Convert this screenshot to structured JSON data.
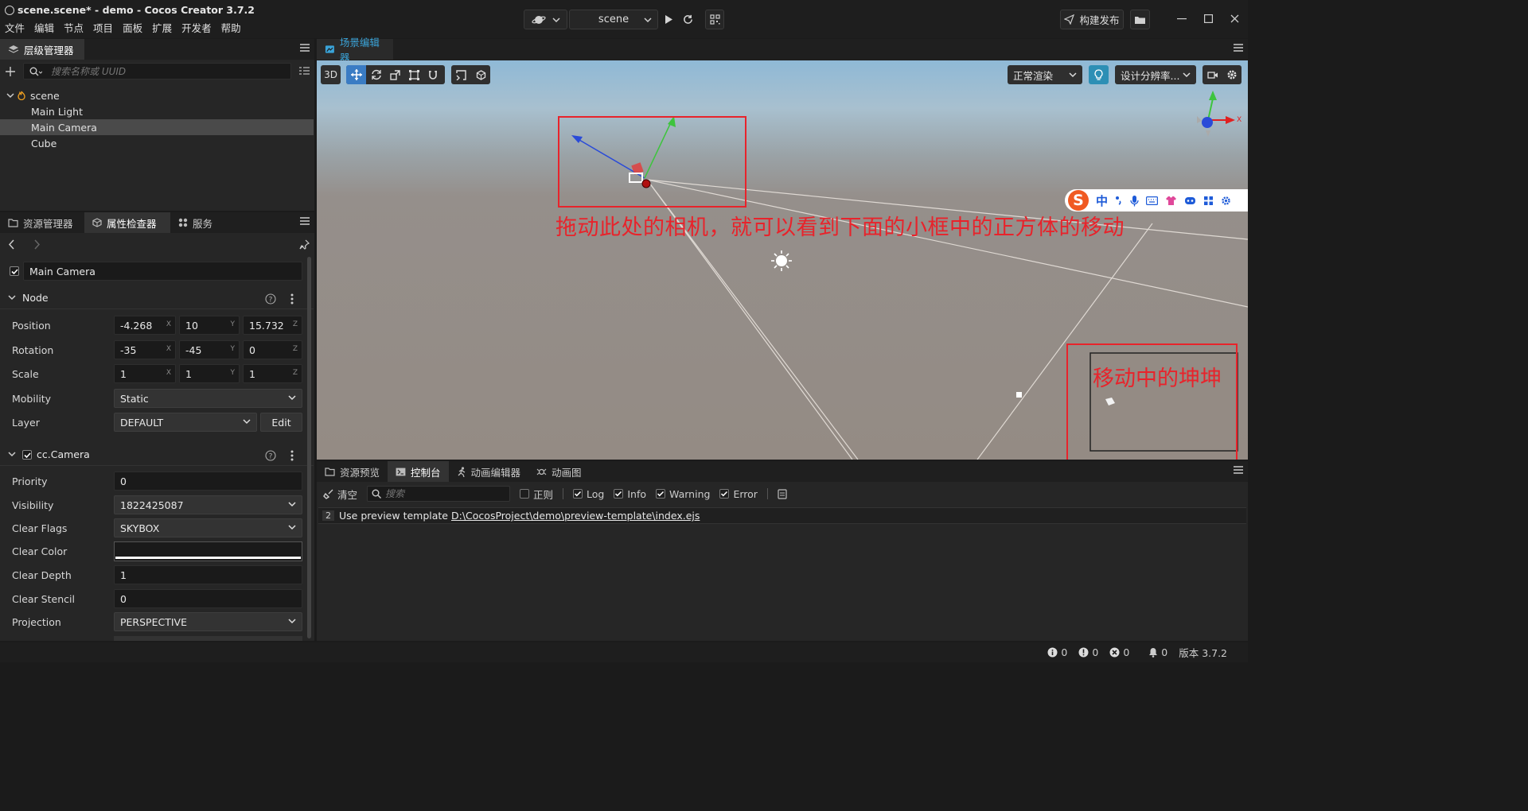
{
  "window": {
    "title": "scene.scene* - demo - Cocos Creator 3.7.2",
    "menu": [
      "文件",
      "编辑",
      "节点",
      "项目",
      "面板",
      "扩展",
      "开发者",
      "帮助"
    ],
    "scene_select": "scene",
    "build_button": "构建发布"
  },
  "hierarchy": {
    "tab": "层级管理器",
    "search_placeholder": "搜索名称或 UUID",
    "root": "scene",
    "items": [
      "Main Light",
      "Main Camera",
      "Cube"
    ],
    "selected": "Main Camera"
  },
  "inspector": {
    "tabs": [
      "资源管理器",
      "属性检查器",
      "服务"
    ],
    "node_name": "Main Camera",
    "node_section": "Node",
    "position_label": "Position",
    "rotation_label": "Rotation",
    "scale_label": "Scale",
    "mobility_label": "Mobility",
    "layer_label": "Layer",
    "position": {
      "x": "-4.268",
      "y": "10",
      "z": "15.732"
    },
    "rotation": {
      "x": "-35",
      "y": "-45",
      "z": "0"
    },
    "scale": {
      "x": "1",
      "y": "1",
      "z": "1"
    },
    "mobility": "Static",
    "layer": "DEFAULT",
    "edit_button": "Edit",
    "camera_section": "cc.Camera",
    "camera_props": [
      {
        "label": "Priority",
        "value": "0",
        "type": "input"
      },
      {
        "label": "Visibility",
        "value": "1822425087",
        "type": "select"
      },
      {
        "label": "Clear Flags",
        "value": "SKYBOX",
        "type": "select"
      },
      {
        "label": "Clear Color",
        "value": "",
        "type": "color"
      },
      {
        "label": "Clear Depth",
        "value": "1",
        "type": "input"
      },
      {
        "label": "Clear Stencil",
        "value": "0",
        "type": "input"
      },
      {
        "label": "Projection",
        "value": "PERSPECTIVE",
        "type": "select"
      }
    ],
    "axis": {
      "x": "X",
      "y": "Y",
      "z": "Z"
    }
  },
  "scene_editor": {
    "tab": "场景编辑器",
    "mode_3d": "3D",
    "render_mode": "正常渲染",
    "resolution": "设计分辨率...",
    "annotation_top": "拖动此处的相机，就可以看到下面的小框中的正方体的移动",
    "annotation_preview": "移动中的坤坤",
    "gizmo_x": "X",
    "ime": {
      "brand": "S",
      "lang": "中"
    },
    "colors": {
      "annotation": "#e8232b",
      "accent": "#3aa3d8",
      "gizmo_x": "#e02020",
      "gizmo_y": "#3ec43e",
      "gizmo_z": "#2a4bd8"
    }
  },
  "console": {
    "tabs": [
      "资源预览",
      "控制台",
      "动画编辑器",
      "动画图"
    ],
    "clear": "清空",
    "search_placeholder": "搜索",
    "filters": [
      {
        "label": "正则",
        "checked": false
      },
      {
        "label": "Log",
        "checked": true
      },
      {
        "label": "Info",
        "checked": true
      },
      {
        "label": "Warning",
        "checked": true
      },
      {
        "label": "Error",
        "checked": true
      }
    ],
    "log_count": "2",
    "log_text": "Use preview template",
    "log_link": "D:\\CocosProject\\demo\\preview-template\\index.ejs"
  },
  "status": {
    "info_count": "0",
    "warn_count": "0",
    "error_count": "0",
    "notice_count": "0",
    "version": "版本 3.7.2"
  }
}
